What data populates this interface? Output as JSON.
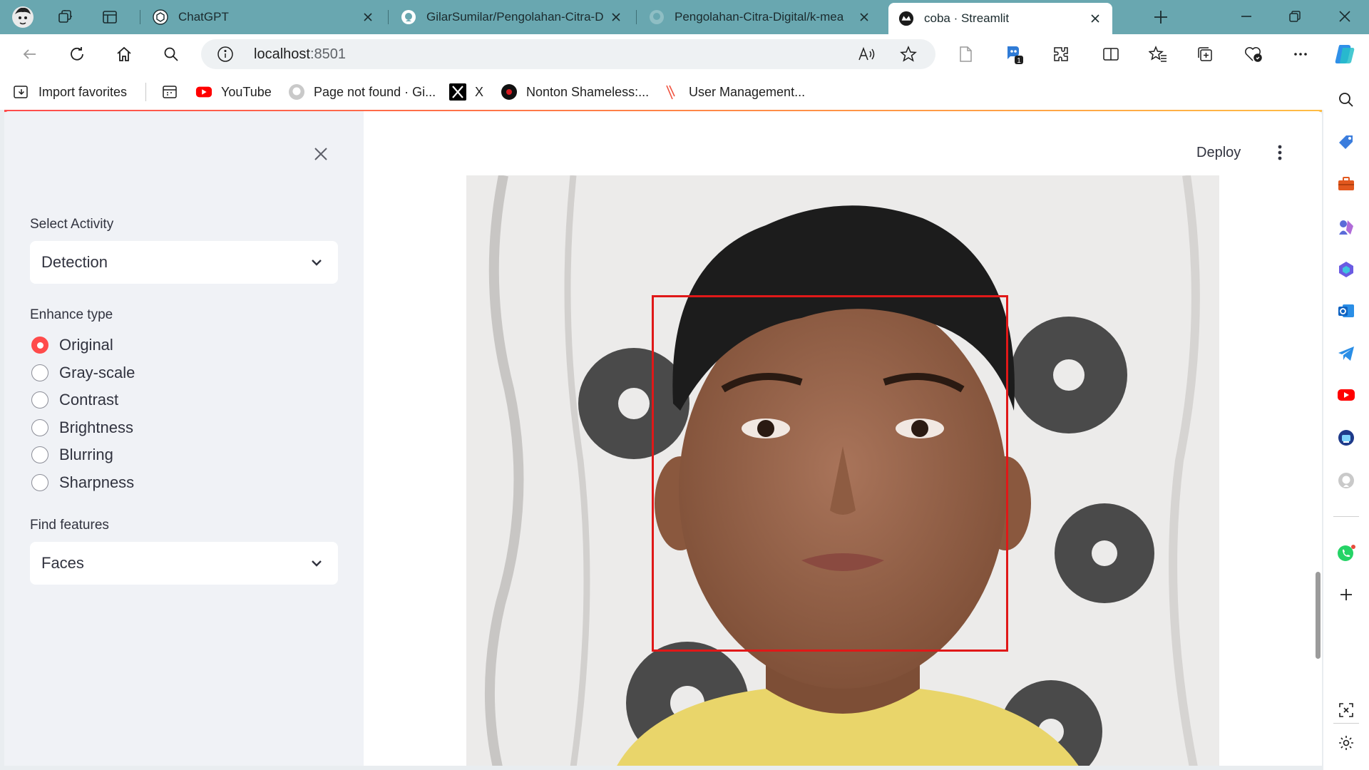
{
  "browser": {
    "tabs": [
      {
        "title": "ChatGPT",
        "favicon": "chatgpt-icon",
        "active": false
      },
      {
        "title": "GilarSumilar/Pengolahan-Citra-D",
        "favicon": "github-icon",
        "active": false
      },
      {
        "title": "Pengolahan-Citra-Digital/k-mea",
        "favicon": "github-icon",
        "active": false
      },
      {
        "title": "coba · Streamlit",
        "favicon": "streamlit-icon",
        "active": true
      }
    ],
    "address": {
      "host": "localhost",
      "port": ":8501"
    },
    "bookmarks": [
      {
        "label": "Import favorites",
        "icon": "import-icon"
      },
      {
        "label": "",
        "icon": "app-icon"
      },
      {
        "label": "YouTube",
        "icon": "youtube-icon"
      },
      {
        "label": "Page not found · Gi...",
        "icon": "github-icon"
      },
      {
        "label": "X",
        "icon": "x-icon"
      },
      {
        "label": "Nonton Shameless:...",
        "icon": "site-icon"
      },
      {
        "label": "User Management...",
        "icon": "laravel-icon"
      }
    ],
    "colors": {
      "titlebar": "#69a7b0",
      "accent": "#ff4b4b"
    }
  },
  "app": {
    "sidebar": {
      "activity": {
        "label": "Select Activity",
        "value": "Detection"
      },
      "enhance": {
        "label": "Enhance type",
        "options": [
          "Original",
          "Gray-scale",
          "Contrast",
          "Brightness",
          "Blurring",
          "Sharpness"
        ],
        "selected": "Original"
      },
      "features": {
        "label": "Find features",
        "value": "Faces"
      }
    },
    "header": {
      "deploy_label": "Deploy"
    }
  }
}
